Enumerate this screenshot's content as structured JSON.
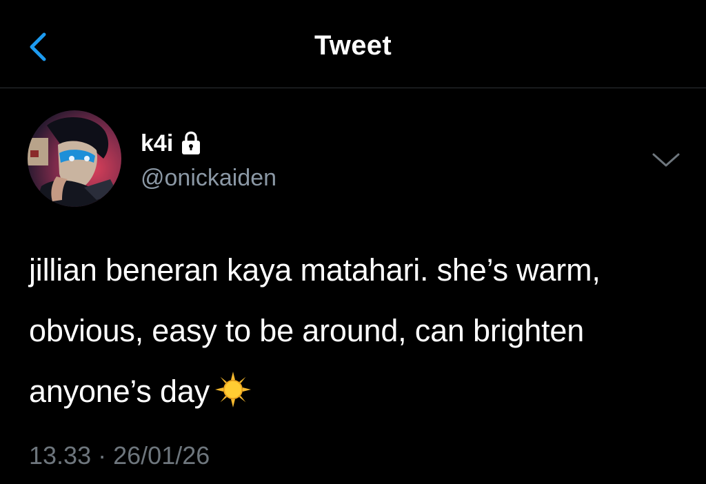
{
  "header": {
    "title": "Tweet",
    "back_icon": "chevron-left-icon",
    "accent_color": "#1d9bf0"
  },
  "author": {
    "display_name": "k4i",
    "handle": "@onickaiden",
    "protected_icon": "lock-icon",
    "avatar_icon": "avatar-image"
  },
  "menu": {
    "icon": "chevron-down-icon"
  },
  "tweet": {
    "text": "jillian beneran kaya matahari. she’s warm, obvious, easy to be around, can brighten anyone’s day",
    "emoji_icon": "sun-icon",
    "time": "13.33",
    "separator": "·",
    "date": "26/01/26"
  }
}
